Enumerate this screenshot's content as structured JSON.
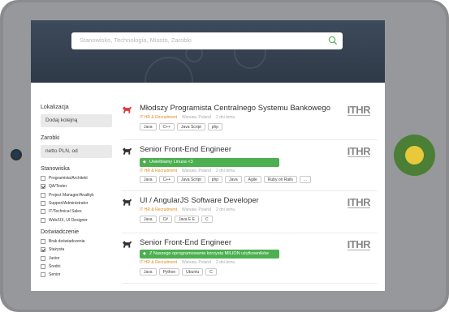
{
  "search": {
    "placeholder": "Stanowisko, Technologia, Miasto, Zarobki"
  },
  "filters": {
    "location": {
      "heading": "Lokalizacja",
      "placeholder": "Dodaj kolejną"
    },
    "salary": {
      "heading": "Zarobki",
      "value": "netto PLN, od"
    },
    "positions": {
      "heading": "Stanowiska",
      "items": [
        {
          "label": "Programista/Architekt",
          "checked": false
        },
        {
          "label": "QA/Tester",
          "checked": true
        },
        {
          "label": "Project Manager/Analityk",
          "checked": false
        },
        {
          "label": "Support/Administrator",
          "checked": false
        },
        {
          "label": "IT/Technical Sales",
          "checked": false
        },
        {
          "label": "Web/UX, UI Designer",
          "checked": false
        }
      ]
    },
    "experience": {
      "heading": "Doświadczenie",
      "items": [
        {
          "label": "Brak doświadczenia",
          "checked": false
        },
        {
          "label": "Stażysta",
          "checked": true
        },
        {
          "label": "Junior",
          "checked": false
        },
        {
          "label": "Średni",
          "checked": false
        },
        {
          "label": "Senior",
          "checked": false
        }
      ]
    }
  },
  "jobs": [
    {
      "title": "Młodszy Programista Centralnego Systemu Bankowego",
      "company": "IT HR & Recruitment",
      "location": "Warsaw, Poland",
      "age": "2 dni temu",
      "banner": "",
      "tags": [
        "Java",
        "C++",
        "Java Script",
        "php"
      ],
      "logo": "ITHR",
      "logo_color": "#e03b3b"
    },
    {
      "title": "Senior Front-End Engineer",
      "company": "IT HR & Recruitment",
      "location": "Warsaw, Poland",
      "age": "2 dni temu",
      "banner": "Uwielbiamy Linuxa <3",
      "tags": [
        "Java",
        "C++",
        "Java Script",
        "php",
        "Java",
        "Agile",
        "Ruby on Rails",
        "..."
      ],
      "logo": "ITHR",
      "logo_color": "#333333"
    },
    {
      "title": "UI / AngularJS Software Developer",
      "company": "IT HR & Recruitment",
      "location": "Warsaw, Poland",
      "age": "2 dni temu",
      "banner": "",
      "tags": [
        "Java",
        "C#",
        "Java E E",
        "C"
      ],
      "logo": "ITHR",
      "logo_color": "#333333"
    },
    {
      "title": "Senior Front-End Engineer",
      "company": "IT HR & Recruitment",
      "location": "Warsaw, Poland",
      "age": "2 dni temu",
      "banner": "Z Naszego oprogramowania korzysta MILION użytkowników",
      "tags": [
        "Java",
        "Python",
        "Ubuntu",
        "C"
      ],
      "logo": "ITHR",
      "logo_color": "#333333"
    }
  ],
  "colors": {
    "accent": "#4caf50",
    "company": "#e08a1e",
    "hero": "#35414f",
    "home_button": "#4a7f35",
    "home_dot": "#e8c93a"
  },
  "icons": {
    "search": "search-icon",
    "company": "scottie-dog-icon",
    "tag": "tag-icon"
  }
}
